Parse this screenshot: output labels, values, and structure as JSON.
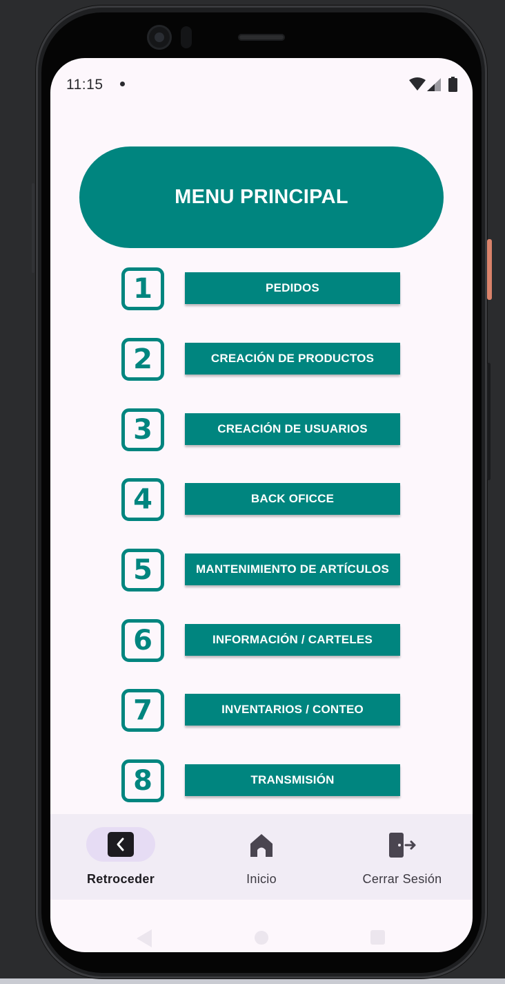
{
  "status_bar": {
    "time": "11:15"
  },
  "header": {
    "title": "MENU PRINCIPAL"
  },
  "menu": [
    {
      "number": "1",
      "label": "PEDIDOS"
    },
    {
      "number": "2",
      "label": "CREACIÓN DE PRODUCTOS"
    },
    {
      "number": "3",
      "label": "CREACIÓN DE USUARIOS"
    },
    {
      "number": "4",
      "label": "BACK OFICCE"
    },
    {
      "number": "5",
      "label": "MANTENIMIENTO DE ARTÍCULOS"
    },
    {
      "number": "6",
      "label": "INFORMACIÓN / CARTELES"
    },
    {
      "number": "7",
      "label": "INVENTARIOS / CONTEO"
    },
    {
      "number": "8",
      "label": "TRANSMISIÓN"
    }
  ],
  "bottom_nav": {
    "items": [
      {
        "label": "Retroceder",
        "icon": "back-chevron-icon",
        "active": true
      },
      {
        "label": "Inicio",
        "icon": "home-icon",
        "active": false
      },
      {
        "label": "Cerrar Sesión",
        "icon": "logout-door-icon",
        "active": false
      }
    ]
  },
  "colors": {
    "primary": "#00857f",
    "screen_background": "#fdf7fc",
    "nav_background": "#f1ecf5",
    "nav_active_indicator": "#e6dcf4"
  }
}
